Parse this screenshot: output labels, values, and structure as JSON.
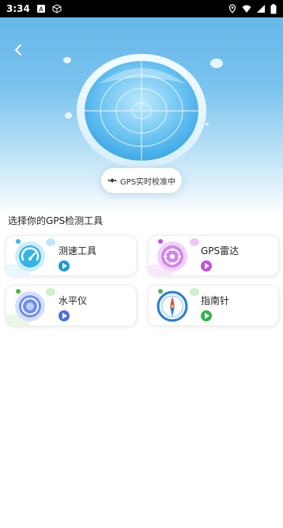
{
  "status_bar": {
    "time": "3:34"
  },
  "hero": {
    "calibration_text": "GPS实时校准中"
  },
  "section": {
    "title": "选择你的GPS检测工具"
  },
  "tools": [
    {
      "label": "测速工具",
      "icon": "speedometer-icon",
      "play_color": "#1a9bd1"
    },
    {
      "label": "GPS雷达",
      "icon": "radar-icon",
      "play_color": "#c24ee0"
    },
    {
      "label": "水平仪",
      "icon": "level-icon",
      "play_color": "#4a6fe3"
    },
    {
      "label": "指南针",
      "icon": "compass-icon",
      "play_color": "#33b24a"
    }
  ],
  "colors": {
    "hero_top": "#67b7ea",
    "accent_blue": "#1a9bd1",
    "accent_purple": "#c24ee0",
    "accent_indigo": "#4a6fe3",
    "accent_green": "#33b24a"
  }
}
